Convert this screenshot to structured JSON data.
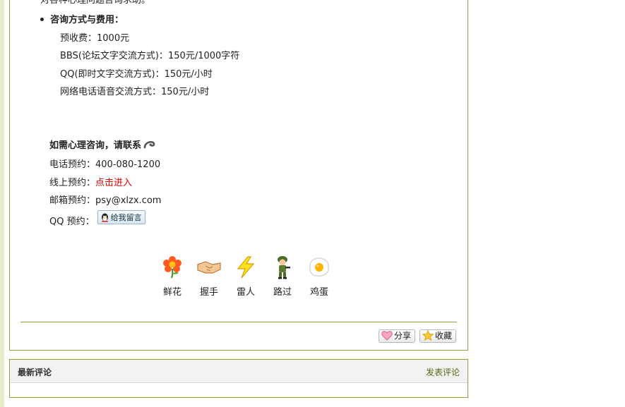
{
  "article": {
    "cut_text": "对各种心理问题咨询求助。",
    "fees_heading": "咨询方式与费用：",
    "fees": [
      "预收费：1000元",
      "BBS(论坛文字交流方式)：150元/1000字符",
      "QQ(即时文字交流方式)：150元/小时",
      "网络电话语音交流方式：150元/小时"
    ],
    "contact_title": "如需心理咨询，请联系",
    "phone_label": "电话预约：",
    "phone_value": "400-080-1200",
    "online_label": "线上预约：",
    "online_link": "点击进入",
    "email_label": "邮箱预约：",
    "email_value": "psy@xlzx.com",
    "qq_label": "QQ 预约：",
    "qq_button": "给我留言"
  },
  "reactions": [
    {
      "label": "鲜花",
      "icon": "flower-icon"
    },
    {
      "label": "握手",
      "icon": "handshake-icon"
    },
    {
      "label": "雷人",
      "icon": "lightning-icon"
    },
    {
      "label": "路过",
      "icon": "soldier-icon"
    },
    {
      "label": "鸡蛋",
      "icon": "egg-icon"
    }
  ],
  "actions": {
    "share": "分享",
    "favorite": "收藏"
  },
  "comments": {
    "title": "最新评论",
    "post_link": "发表评论"
  },
  "colors": {
    "border_green": "#8aa43a",
    "link_red": "#e00000",
    "link_green": "#4e6b12"
  }
}
